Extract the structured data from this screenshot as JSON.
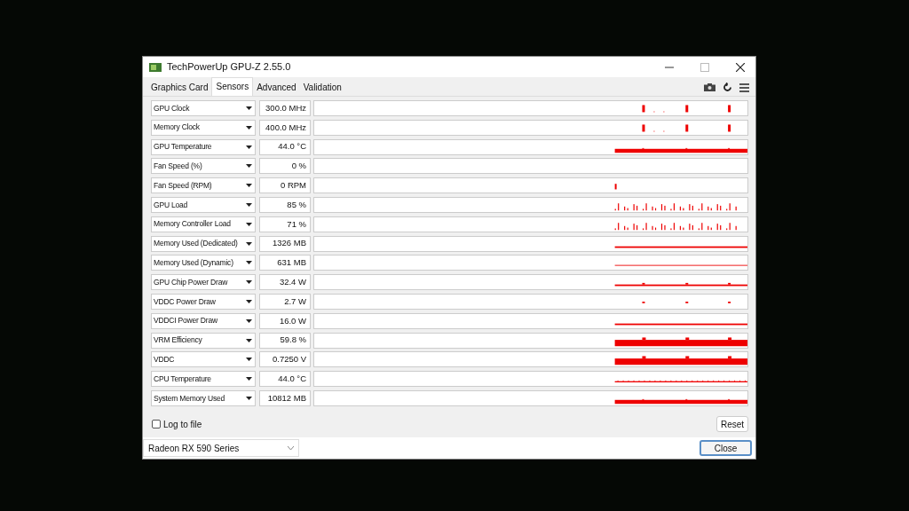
{
  "window": {
    "title": "TechPowerUp GPU-Z 2.55.0"
  },
  "tabs": [
    {
      "label": "Graphics Card",
      "selected": false
    },
    {
      "label": "Sensors",
      "selected": true
    },
    {
      "label": "Advanced",
      "selected": false
    },
    {
      "label": "Validation",
      "selected": false
    }
  ],
  "sensors": [
    {
      "name": "GPU Clock",
      "reading": "300.0 MHz",
      "kind": "spikes"
    },
    {
      "name": "Memory Clock",
      "reading": "400.0 MHz",
      "kind": "spikes"
    },
    {
      "name": "GPU Temperature",
      "reading": "44.0 °C",
      "kind": "band"
    },
    {
      "name": "Fan Speed (%)",
      "reading": "0 %",
      "kind": "empty"
    },
    {
      "name": "Fan Speed (RPM)",
      "reading": "0 RPM",
      "kind": "dot"
    },
    {
      "name": "GPU Load",
      "reading": "85 %",
      "kind": "noise"
    },
    {
      "name": "Memory Controller Load",
      "reading": "71 %",
      "kind": "noise"
    },
    {
      "name": "Memory Used (Dedicated)",
      "reading": "1326 MB",
      "kind": "line"
    },
    {
      "name": "Memory Used (Dynamic)",
      "reading": "631 MB",
      "kind": "thin"
    },
    {
      "name": "GPU Chip Power Draw",
      "reading": "32.4 W",
      "kind": "linebumps"
    },
    {
      "name": "VDDC Power Draw",
      "reading": "2.7 W",
      "kind": "dots"
    },
    {
      "name": "VDDCI Power Draw",
      "reading": "16.0 W",
      "kind": "line"
    },
    {
      "name": "VRM Efficiency",
      "reading": "59.8 %",
      "kind": "thick"
    },
    {
      "name": "VDDC",
      "reading": "0.7250 V",
      "kind": "thick"
    },
    {
      "name": "CPU Temperature",
      "reading": "44.0 °C",
      "kind": "fuzz"
    },
    {
      "name": "System Memory Used",
      "reading": "10812 MB",
      "kind": "band"
    }
  ],
  "log_to_file": {
    "label": "Log to file",
    "checked": false
  },
  "reset_button": "Reset",
  "device": "Radeon RX 590 Series",
  "close_button": "Close"
}
